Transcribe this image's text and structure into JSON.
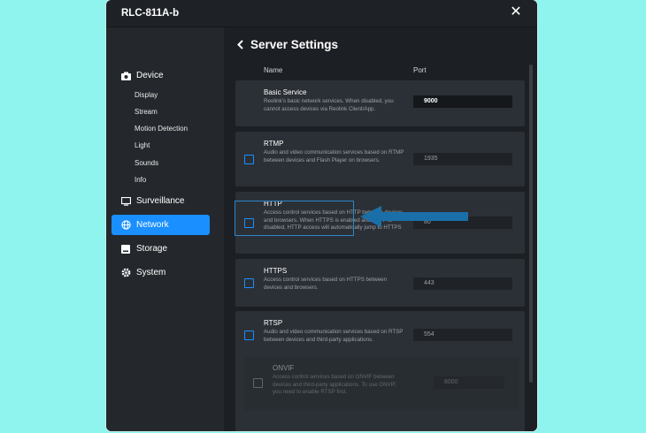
{
  "window": {
    "title": "RLC-811A-b",
    "close_icon": "close-icon"
  },
  "sidebar": {
    "device": {
      "label": "Device",
      "icon": "camera-icon"
    },
    "device_items": [
      "Display",
      "Stream",
      "Motion Detection",
      "Light",
      "Sounds",
      "Info"
    ],
    "surveillance": {
      "label": "Surveillance",
      "icon": "surveillance-icon"
    },
    "network": {
      "label": "Network",
      "icon": "globe-icon"
    },
    "storage": {
      "label": "Storage",
      "icon": "storage-icon"
    },
    "system": {
      "label": "System",
      "icon": "gear-icon"
    }
  },
  "main": {
    "title": "Server Settings",
    "columns": {
      "name": "Name",
      "port": "Port"
    },
    "services": [
      {
        "name": "Basic Service",
        "desc": "Reolink's basic network services. When disabled, you cannot access devices via Reolink Client/App.",
        "port": "9000"
      },
      {
        "name": "RTMP",
        "desc": "Audio and video communication services based on RTMP between devices and Flash Player on browsers.",
        "port": "1935"
      },
      {
        "name": "HTTP",
        "desc": "Access control services based on HTTP between devices and browsers. When HTTPS is enabled and HTTP is disabled, HTTP access will automatically jump to HTTPS",
        "port": "80"
      },
      {
        "name": "HTTPS",
        "desc": "Access control services based on HTTPS between devices and browsers.",
        "port": "443"
      },
      {
        "name": "RTSP",
        "desc": "Audio and video communication services based on RTSP between devices and third-party applications.",
        "port": "554"
      }
    ],
    "onvif": {
      "name": "ONVIF",
      "desc": "Access control services based on ONVIF between devices and third-party applications. To use ONVIF, you need to enable RTSP first.",
      "port": "8000"
    }
  },
  "colors": {
    "accent": "#1a8fff",
    "annotation": "#1b6fa8",
    "background": "#8ff3ee"
  }
}
